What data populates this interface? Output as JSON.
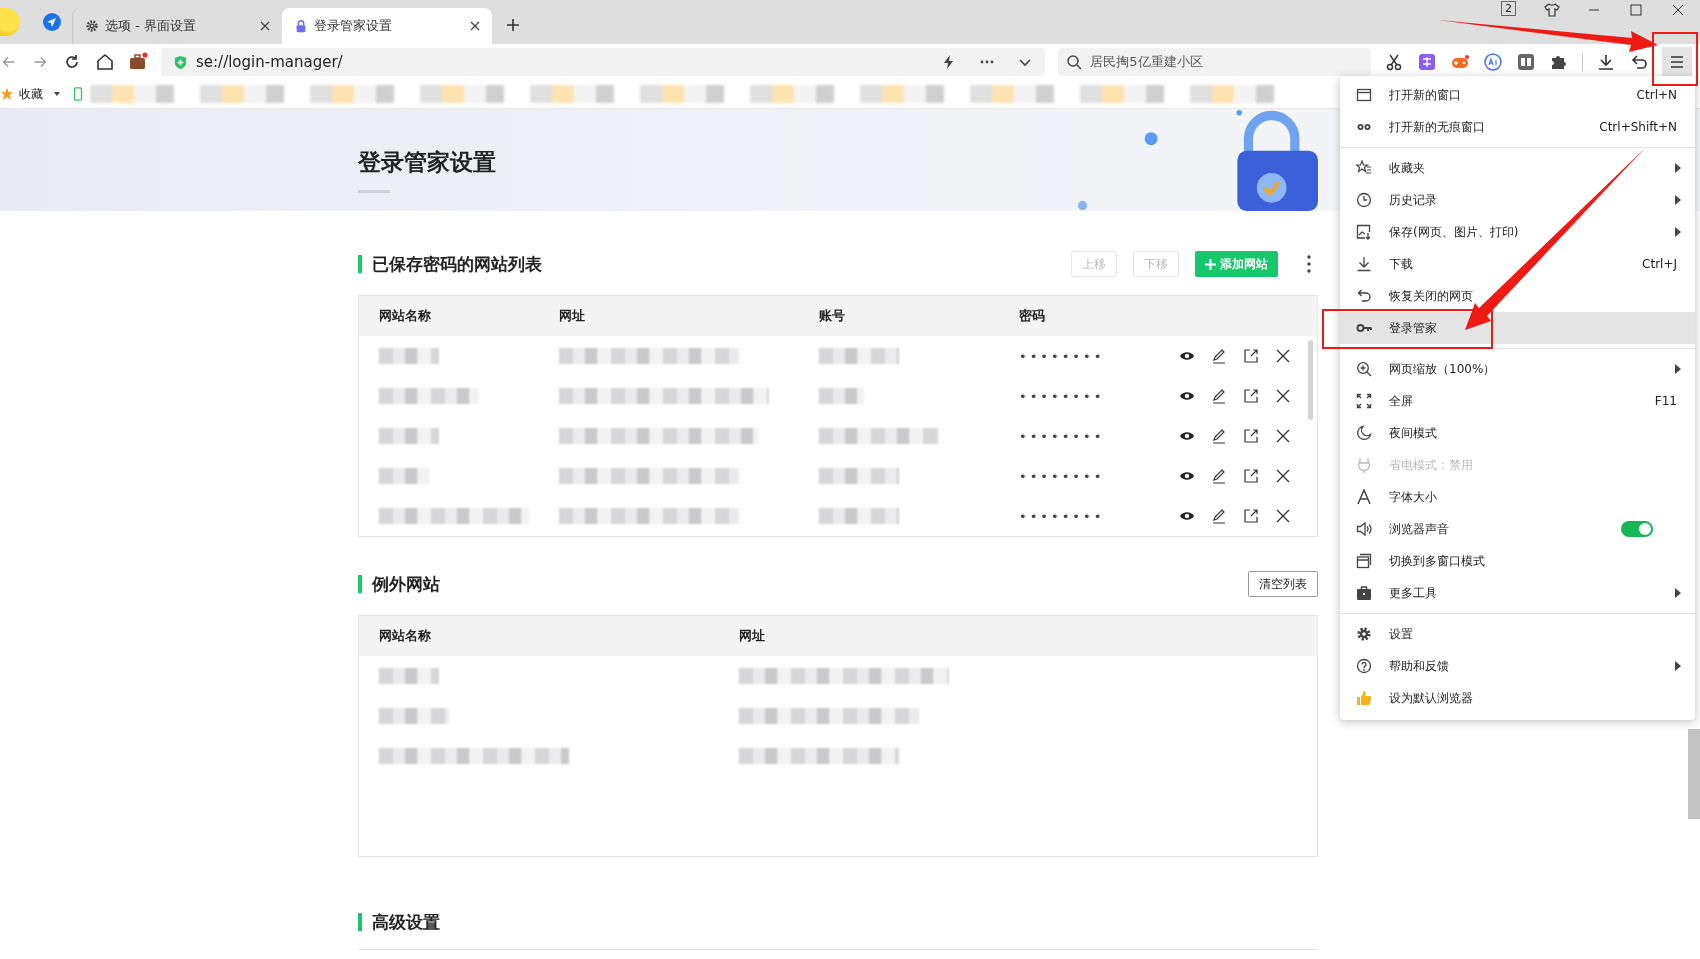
{
  "tabs": [
    {
      "title": "选项 - 界面设置",
      "selected": false
    },
    {
      "title": "登录管家设置",
      "selected": true
    }
  ],
  "window_controls": {
    "window_count": "2"
  },
  "address_bar": {
    "url": "se://login-manager/"
  },
  "search_box": {
    "value": "居民掏5亿重建小区"
  },
  "bookmarks_bar": {
    "label": "收藏"
  },
  "page": {
    "title": "登录管家设置",
    "saved_sites": {
      "title": "已保存密码的网站列表",
      "buttons": [
        {
          "label": "上移",
          "kind": "plain",
          "disabled": true
        },
        {
          "label": "下移",
          "kind": "plain",
          "disabled": true
        },
        {
          "label": "添加网站",
          "kind": "primary",
          "disabled": false
        }
      ],
      "columns": [
        "网站名称",
        "网址",
        "账号",
        "密码"
      ],
      "rows": [
        {
          "password": "••••••••"
        },
        {
          "password": "••••••••"
        },
        {
          "password": "••••••••"
        },
        {
          "password": "••••••••"
        },
        {
          "password": "••••••••"
        }
      ]
    },
    "exception_sites": {
      "title": "例外网站",
      "clear_button": "清空列表",
      "columns": [
        "网站名称",
        "网址"
      ]
    },
    "advanced": {
      "title": "高级设置"
    }
  },
  "menu": {
    "items": [
      {
        "kind": "item",
        "label": "打开新的窗口",
        "shortcut": "Ctrl+N",
        "submenu": false,
        "disabled": false,
        "highlighted": false
      },
      {
        "kind": "item",
        "label": "打开新的无痕窗口",
        "shortcut": "Ctrl+Shift+N",
        "submenu": false,
        "disabled": false,
        "highlighted": false
      },
      {
        "kind": "separator"
      },
      {
        "kind": "item",
        "label": "收藏夹",
        "submenu": true,
        "disabled": false,
        "highlighted": false
      },
      {
        "kind": "item",
        "label": "历史记录",
        "submenu": true,
        "disabled": false,
        "highlighted": false
      },
      {
        "kind": "item",
        "label": "保存(网页、图片、打印)",
        "submenu": true,
        "disabled": false,
        "highlighted": false
      },
      {
        "kind": "item",
        "label": "下载",
        "shortcut": "Ctrl+J",
        "submenu": false,
        "disabled": false,
        "highlighted": false
      },
      {
        "kind": "item",
        "label": "恢复关闭的网页",
        "submenu": false,
        "disabled": false,
        "highlighted": false
      },
      {
        "kind": "item",
        "label": "登录管家",
        "submenu": false,
        "disabled": false,
        "highlighted": true
      },
      {
        "kind": "separator"
      },
      {
        "kind": "item",
        "label": "网页缩放（100%）",
        "submenu": true,
        "disabled": false,
        "highlighted": false
      },
      {
        "kind": "item",
        "label": "全屏",
        "shortcut": "F11",
        "submenu": false,
        "disabled": false,
        "highlighted": false
      },
      {
        "kind": "item",
        "label": "夜间模式",
        "submenu": false,
        "disabled": false,
        "highlighted": false
      },
      {
        "kind": "item",
        "label": "省电模式：禁用",
        "submenu": false,
        "disabled": true,
        "highlighted": false
      },
      {
        "kind": "item",
        "label": "字体大小",
        "submenu": false,
        "disabled": false,
        "highlighted": false
      },
      {
        "kind": "toggle",
        "label": "浏览器声音",
        "on": true,
        "disabled": false,
        "highlighted": false
      },
      {
        "kind": "item",
        "label": "切换到多窗口模式",
        "submenu": false,
        "disabled": false,
        "highlighted": false
      },
      {
        "kind": "item",
        "label": "更多工具",
        "submenu": true,
        "disabled": false,
        "highlighted": false
      },
      {
        "kind": "separator"
      },
      {
        "kind": "item",
        "label": "设置",
        "submenu": false,
        "disabled": false,
        "highlighted": false
      },
      {
        "kind": "item",
        "label": "帮助和反馈",
        "submenu": true,
        "disabled": false,
        "highlighted": false
      },
      {
        "kind": "item",
        "label": "设为默认浏览器",
        "submenu": false,
        "disabled": false,
        "highlighted": false
      }
    ]
  }
}
